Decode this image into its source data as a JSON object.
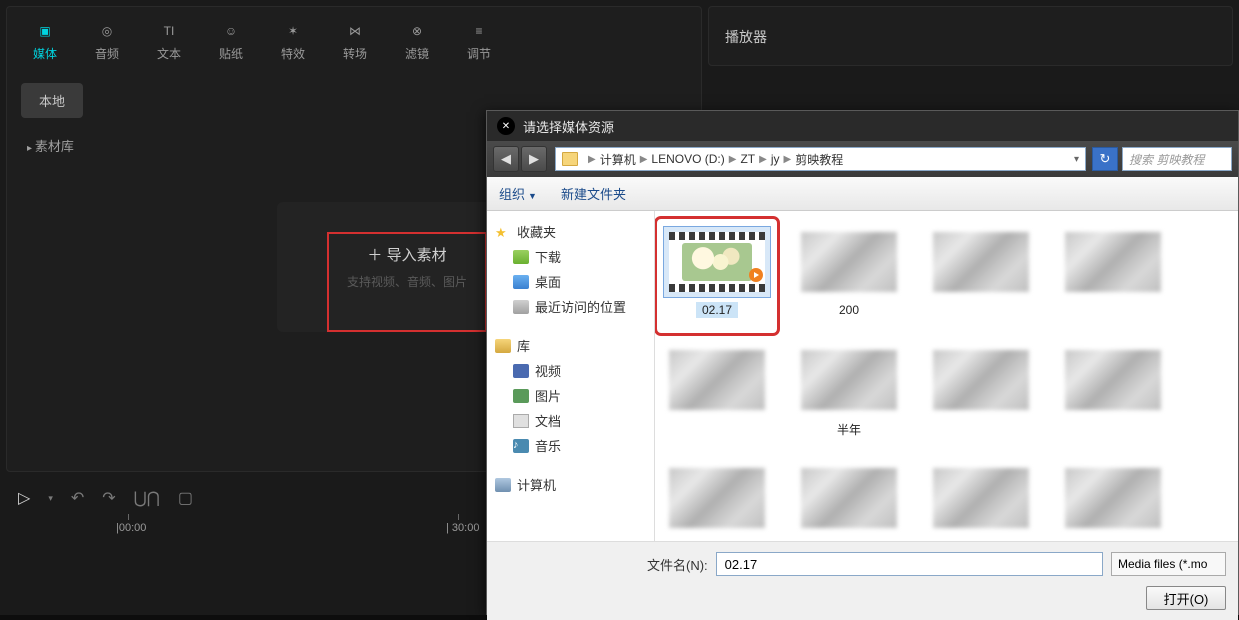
{
  "toolTabs": [
    {
      "label": "媒体",
      "icon": "media"
    },
    {
      "label": "音频",
      "icon": "audio"
    },
    {
      "label": "文本",
      "icon": "text"
    },
    {
      "label": "贴纸",
      "icon": "sticker"
    },
    {
      "label": "特效",
      "icon": "effect"
    },
    {
      "label": "转场",
      "icon": "transition"
    },
    {
      "label": "滤镜",
      "icon": "filter"
    },
    {
      "label": "调节",
      "icon": "adjust"
    }
  ],
  "sideTabs": {
    "local": "本地",
    "library": "素材库"
  },
  "importZone": {
    "title": "导入素材",
    "hint": "支持视频、音频、图片"
  },
  "previewTitle": "播放器",
  "timeline": {
    "t0": "00:00",
    "t1": "30:00"
  },
  "dialog": {
    "title": "请选择媒体资源",
    "breadcrumb": [
      "计算机",
      "LENOVO (D:)",
      "ZT",
      "jy",
      "剪映教程"
    ],
    "searchPlaceholder": "搜索 剪映教程",
    "toolbar": {
      "organize": "组织",
      "newFolder": "新建文件夹"
    },
    "nav": {
      "favorites": "收藏夹",
      "downloads": "下载",
      "desktop": "桌面",
      "recent": "最近访问的位置",
      "libraries": "库",
      "videos": "视频",
      "pictures": "图片",
      "documents": "文档",
      "music": "音乐",
      "computer": "计算机"
    },
    "files": [
      {
        "label": "02.17",
        "selected": true
      },
      {
        "label": "200"
      },
      {
        "label": ""
      },
      {
        "label": ""
      },
      {
        "label": ""
      },
      {
        "label": "半年"
      },
      {
        "label": ""
      },
      {
        "label": ""
      },
      {
        "label": ""
      },
      {
        "label": ""
      },
      {
        "label": ""
      },
      {
        "label": ""
      }
    ],
    "footer": {
      "filenameLabel": "文件名(N):",
      "filenameValue": "02.17",
      "filterValue": "Media files (*.mo",
      "openLabel": "打开(O)"
    }
  }
}
